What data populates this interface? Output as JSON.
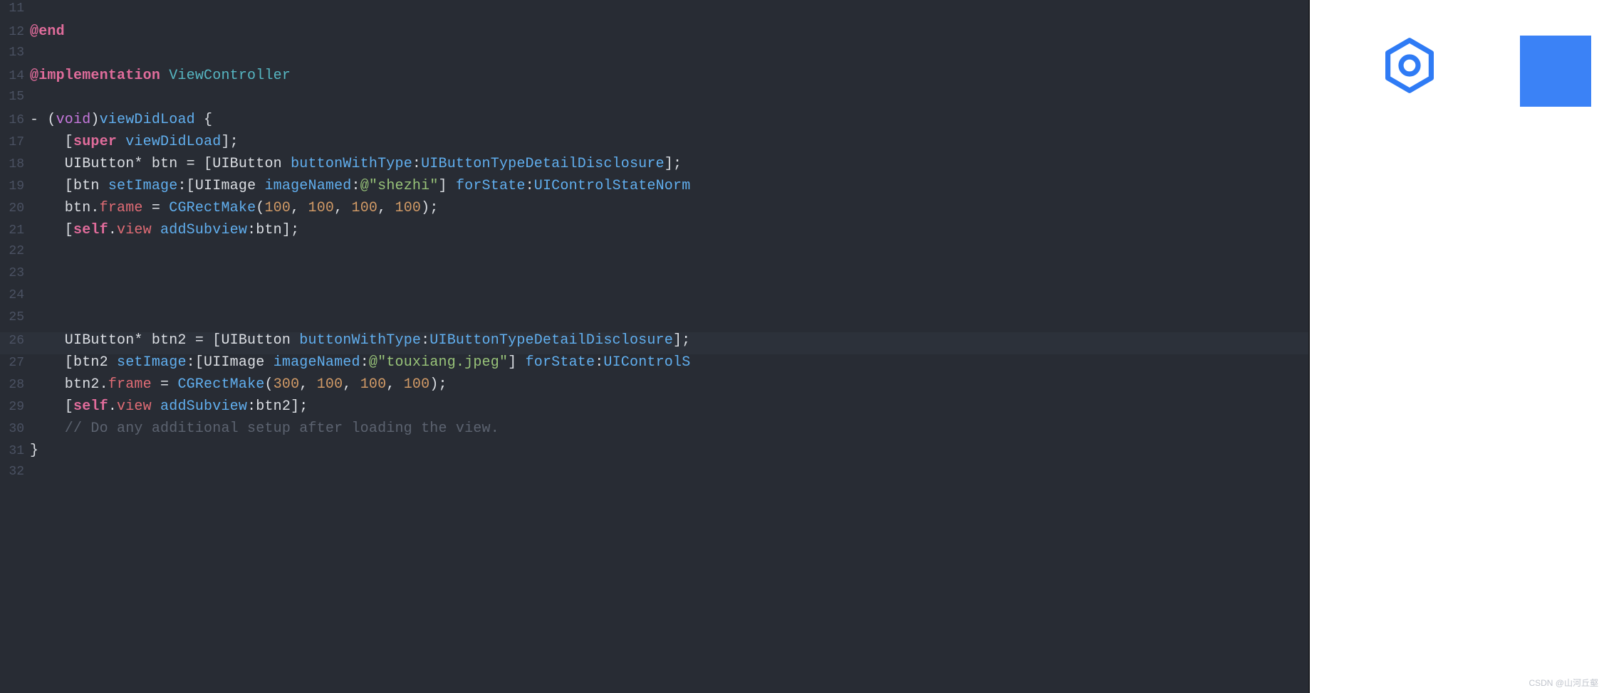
{
  "editor": {
    "highlight_line": 26,
    "lines": [
      {
        "n": 11,
        "tokens": []
      },
      {
        "n": 12,
        "tokens": [
          {
            "t": "@end",
            "c": "kw-pink"
          }
        ]
      },
      {
        "n": 13,
        "tokens": []
      },
      {
        "n": 14,
        "tokens": [
          {
            "t": "@implementation",
            "c": "kw-pink"
          },
          {
            "t": " ",
            "c": "ident"
          },
          {
            "t": "ViewController",
            "c": "type-cyan"
          }
        ]
      },
      {
        "n": 15,
        "tokens": []
      },
      {
        "n": 16,
        "tokens": [
          {
            "t": "- (",
            "c": "white"
          },
          {
            "t": "void",
            "c": "kw-purple"
          },
          {
            "t": ")",
            "c": "white"
          },
          {
            "t": "viewDidLoad",
            "c": "fn-blue"
          },
          {
            "t": " {",
            "c": "white"
          }
        ]
      },
      {
        "n": 17,
        "tokens": [
          {
            "t": "    [",
            "c": "white"
          },
          {
            "t": "super",
            "c": "kw-pink"
          },
          {
            "t": " ",
            "c": "ident"
          },
          {
            "t": "viewDidLoad",
            "c": "fn-blue"
          },
          {
            "t": "];",
            "c": "white"
          }
        ]
      },
      {
        "n": 18,
        "tokens": [
          {
            "t": "    UIButton* btn = [UIButton ",
            "c": "white"
          },
          {
            "t": "buttonWithType",
            "c": "fn-blue"
          },
          {
            "t": ":",
            "c": "white"
          },
          {
            "t": "UIButtonTypeDetailDisclosure",
            "c": "fn-blue"
          },
          {
            "t": "];",
            "c": "white"
          }
        ]
      },
      {
        "n": 19,
        "tokens": [
          {
            "t": "    [btn ",
            "c": "white"
          },
          {
            "t": "setImage",
            "c": "fn-blue"
          },
          {
            "t": ":[UIImage ",
            "c": "white"
          },
          {
            "t": "imageNamed",
            "c": "fn-blue"
          },
          {
            "t": ":",
            "c": "white"
          },
          {
            "t": "@\"shezhi\"",
            "c": "str"
          },
          {
            "t": "] ",
            "c": "white"
          },
          {
            "t": "forState",
            "c": "fn-blue"
          },
          {
            "t": ":",
            "c": "white"
          },
          {
            "t": "UIControlStateNorm",
            "c": "fn-blue"
          }
        ]
      },
      {
        "n": 20,
        "tokens": [
          {
            "t": "    btn.",
            "c": "white"
          },
          {
            "t": "frame",
            "c": "prop-red"
          },
          {
            "t": " = ",
            "c": "white"
          },
          {
            "t": "CGRectMake",
            "c": "fn-blue"
          },
          {
            "t": "(",
            "c": "white"
          },
          {
            "t": "100",
            "c": "num"
          },
          {
            "t": ", ",
            "c": "white"
          },
          {
            "t": "100",
            "c": "num"
          },
          {
            "t": ", ",
            "c": "white"
          },
          {
            "t": "100",
            "c": "num"
          },
          {
            "t": ", ",
            "c": "white"
          },
          {
            "t": "100",
            "c": "num"
          },
          {
            "t": ");",
            "c": "white"
          }
        ]
      },
      {
        "n": 21,
        "tokens": [
          {
            "t": "    [",
            "c": "white"
          },
          {
            "t": "self",
            "c": "kw-pink"
          },
          {
            "t": ".",
            "c": "white"
          },
          {
            "t": "view",
            "c": "prop-red"
          },
          {
            "t": " ",
            "c": "white"
          },
          {
            "t": "addSubview",
            "c": "fn-blue"
          },
          {
            "t": ":btn];",
            "c": "white"
          }
        ]
      },
      {
        "n": 22,
        "tokens": []
      },
      {
        "n": 23,
        "tokens": []
      },
      {
        "n": 24,
        "tokens": []
      },
      {
        "n": 25,
        "tokens": []
      },
      {
        "n": 26,
        "tokens": [
          {
            "t": "    UIButton* btn2 = [UIButton ",
            "c": "white"
          },
          {
            "t": "buttonWithType",
            "c": "fn-blue"
          },
          {
            "t": ":",
            "c": "white"
          },
          {
            "t": "UIButtonTypeDetailDisclosure",
            "c": "fn-blue"
          },
          {
            "t": "];",
            "c": "white"
          }
        ]
      },
      {
        "n": 27,
        "tokens": [
          {
            "t": "    [btn2 ",
            "c": "white"
          },
          {
            "t": "setImage",
            "c": "fn-blue"
          },
          {
            "t": ":[UIImage ",
            "c": "white"
          },
          {
            "t": "imageNamed",
            "c": "fn-blue"
          },
          {
            "t": ":",
            "c": "white"
          },
          {
            "t": "@\"touxiang.jpeg\"",
            "c": "str"
          },
          {
            "t": "] ",
            "c": "white"
          },
          {
            "t": "forState",
            "c": "fn-blue"
          },
          {
            "t": ":",
            "c": "white"
          },
          {
            "t": "UIControlS",
            "c": "fn-blue"
          }
        ]
      },
      {
        "n": 28,
        "tokens": [
          {
            "t": "    btn2.",
            "c": "white"
          },
          {
            "t": "frame",
            "c": "prop-red"
          },
          {
            "t": " = ",
            "c": "white"
          },
          {
            "t": "CGRectMake",
            "c": "fn-blue"
          },
          {
            "t": "(",
            "c": "white"
          },
          {
            "t": "300",
            "c": "num"
          },
          {
            "t": ", ",
            "c": "white"
          },
          {
            "t": "100",
            "c": "num"
          },
          {
            "t": ", ",
            "c": "white"
          },
          {
            "t": "100",
            "c": "num"
          },
          {
            "t": ", ",
            "c": "white"
          },
          {
            "t": "100",
            "c": "num"
          },
          {
            "t": ");",
            "c": "white"
          }
        ]
      },
      {
        "n": 29,
        "tokens": [
          {
            "t": "    [",
            "c": "white"
          },
          {
            "t": "self",
            "c": "kw-pink"
          },
          {
            "t": ".",
            "c": "white"
          },
          {
            "t": "view",
            "c": "prop-red"
          },
          {
            "t": " ",
            "c": "white"
          },
          {
            "t": "addSubview",
            "c": "fn-blue"
          },
          {
            "t": ":btn2];",
            "c": "white"
          }
        ]
      },
      {
        "n": 30,
        "tokens": [
          {
            "t": "    // Do any additional setup after loading the view.",
            "c": "comment"
          }
        ]
      },
      {
        "n": 31,
        "tokens": [
          {
            "t": "}",
            "c": "white"
          }
        ]
      },
      {
        "n": 32,
        "tokens": []
      }
    ]
  },
  "simulator": {
    "btn1": {
      "icon": "hex-gear",
      "color": "#2f7bf5"
    },
    "btn2": {
      "fill": "#3b82f6"
    }
  },
  "watermark": "CSDN @山河丘壑"
}
